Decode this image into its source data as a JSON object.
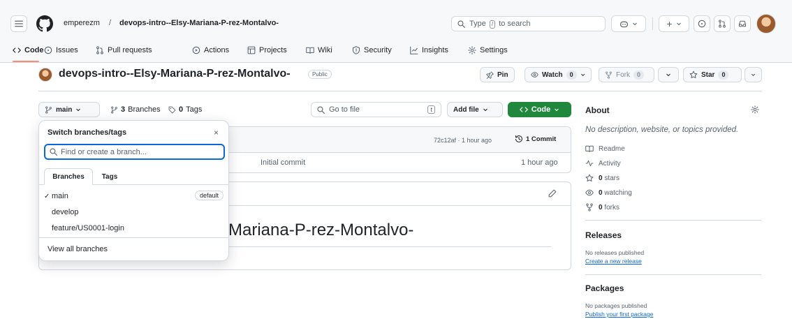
{
  "header": {
    "owner": "emperezm",
    "separator": "/",
    "repo": "devops-intro--Elsy-Mariana-P-rez-Montalvo-",
    "search": {
      "prefix": "Type",
      "key": "/",
      "suffix": "to search"
    },
    "plus_label": "+"
  },
  "tabs": [
    {
      "label": "Code",
      "icon": "code-icon"
    },
    {
      "label": "Issues",
      "icon": "issue-icon"
    },
    {
      "label": "Pull requests",
      "icon": "pull-request-icon"
    },
    {
      "label": "Actions",
      "icon": "play-icon"
    },
    {
      "label": "Projects",
      "icon": "table-icon"
    },
    {
      "label": "Wiki",
      "icon": "book-icon"
    },
    {
      "label": "Security",
      "icon": "shield-icon"
    },
    {
      "label": "Insights",
      "icon": "graph-icon"
    },
    {
      "label": "Settings",
      "icon": "gear-icon"
    }
  ],
  "repo_header": {
    "title": "devops-intro--Elsy-Mariana-P-rez-Montalvo-",
    "visibility": "Public",
    "pin_label": "Pin",
    "watch_label": "Watch",
    "watch_count": "0",
    "fork_label": "Fork",
    "fork_count": "0",
    "star_label": "Star",
    "star_count": "0"
  },
  "branch_bar": {
    "branch": "main",
    "branches_count": "3",
    "branches_label": "Branches",
    "tags_count": "0",
    "tags_label": "Tags",
    "goto_placeholder": "Go to file",
    "goto_key": "t",
    "add_file_label": "Add file",
    "code_label": "Code"
  },
  "commit_box": {
    "hash_time": "72c12af · 1 hour ago",
    "commits_label": "1 Commit",
    "file_message": "Initial commit",
    "file_time": "1 hour ago"
  },
  "readme": {
    "heading_visible": "Mariana-P-rez-Montalvo-"
  },
  "about": {
    "title": "About",
    "description": "No description, website, or topics provided.",
    "readme_label": "Readme",
    "activity_label": "Activity",
    "stars_count": "0",
    "stars_label": "stars",
    "watching_count": "0",
    "watching_label": "watching",
    "forks_count": "0",
    "forks_label": "forks"
  },
  "releases": {
    "title": "Releases",
    "empty": "No releases published",
    "create_link": "Create a new release"
  },
  "packages": {
    "title": "Packages",
    "empty": "No packages published",
    "publish_link": "Publish your first package"
  },
  "dropdown": {
    "title": "Switch branches/tags",
    "close": "×",
    "placeholder": "Find or create a branch...",
    "tab_branches": "Branches",
    "tab_tags": "Tags",
    "check": "✓",
    "items": [
      "main",
      "develop",
      "feature/US0001-login"
    ],
    "default_badge": "default",
    "view_all": "View all branches"
  },
  "colors": {
    "accent": "#0969da",
    "green": "#1f883d",
    "tab_underline": "#fd8c73",
    "border": "#d1d9e0"
  }
}
